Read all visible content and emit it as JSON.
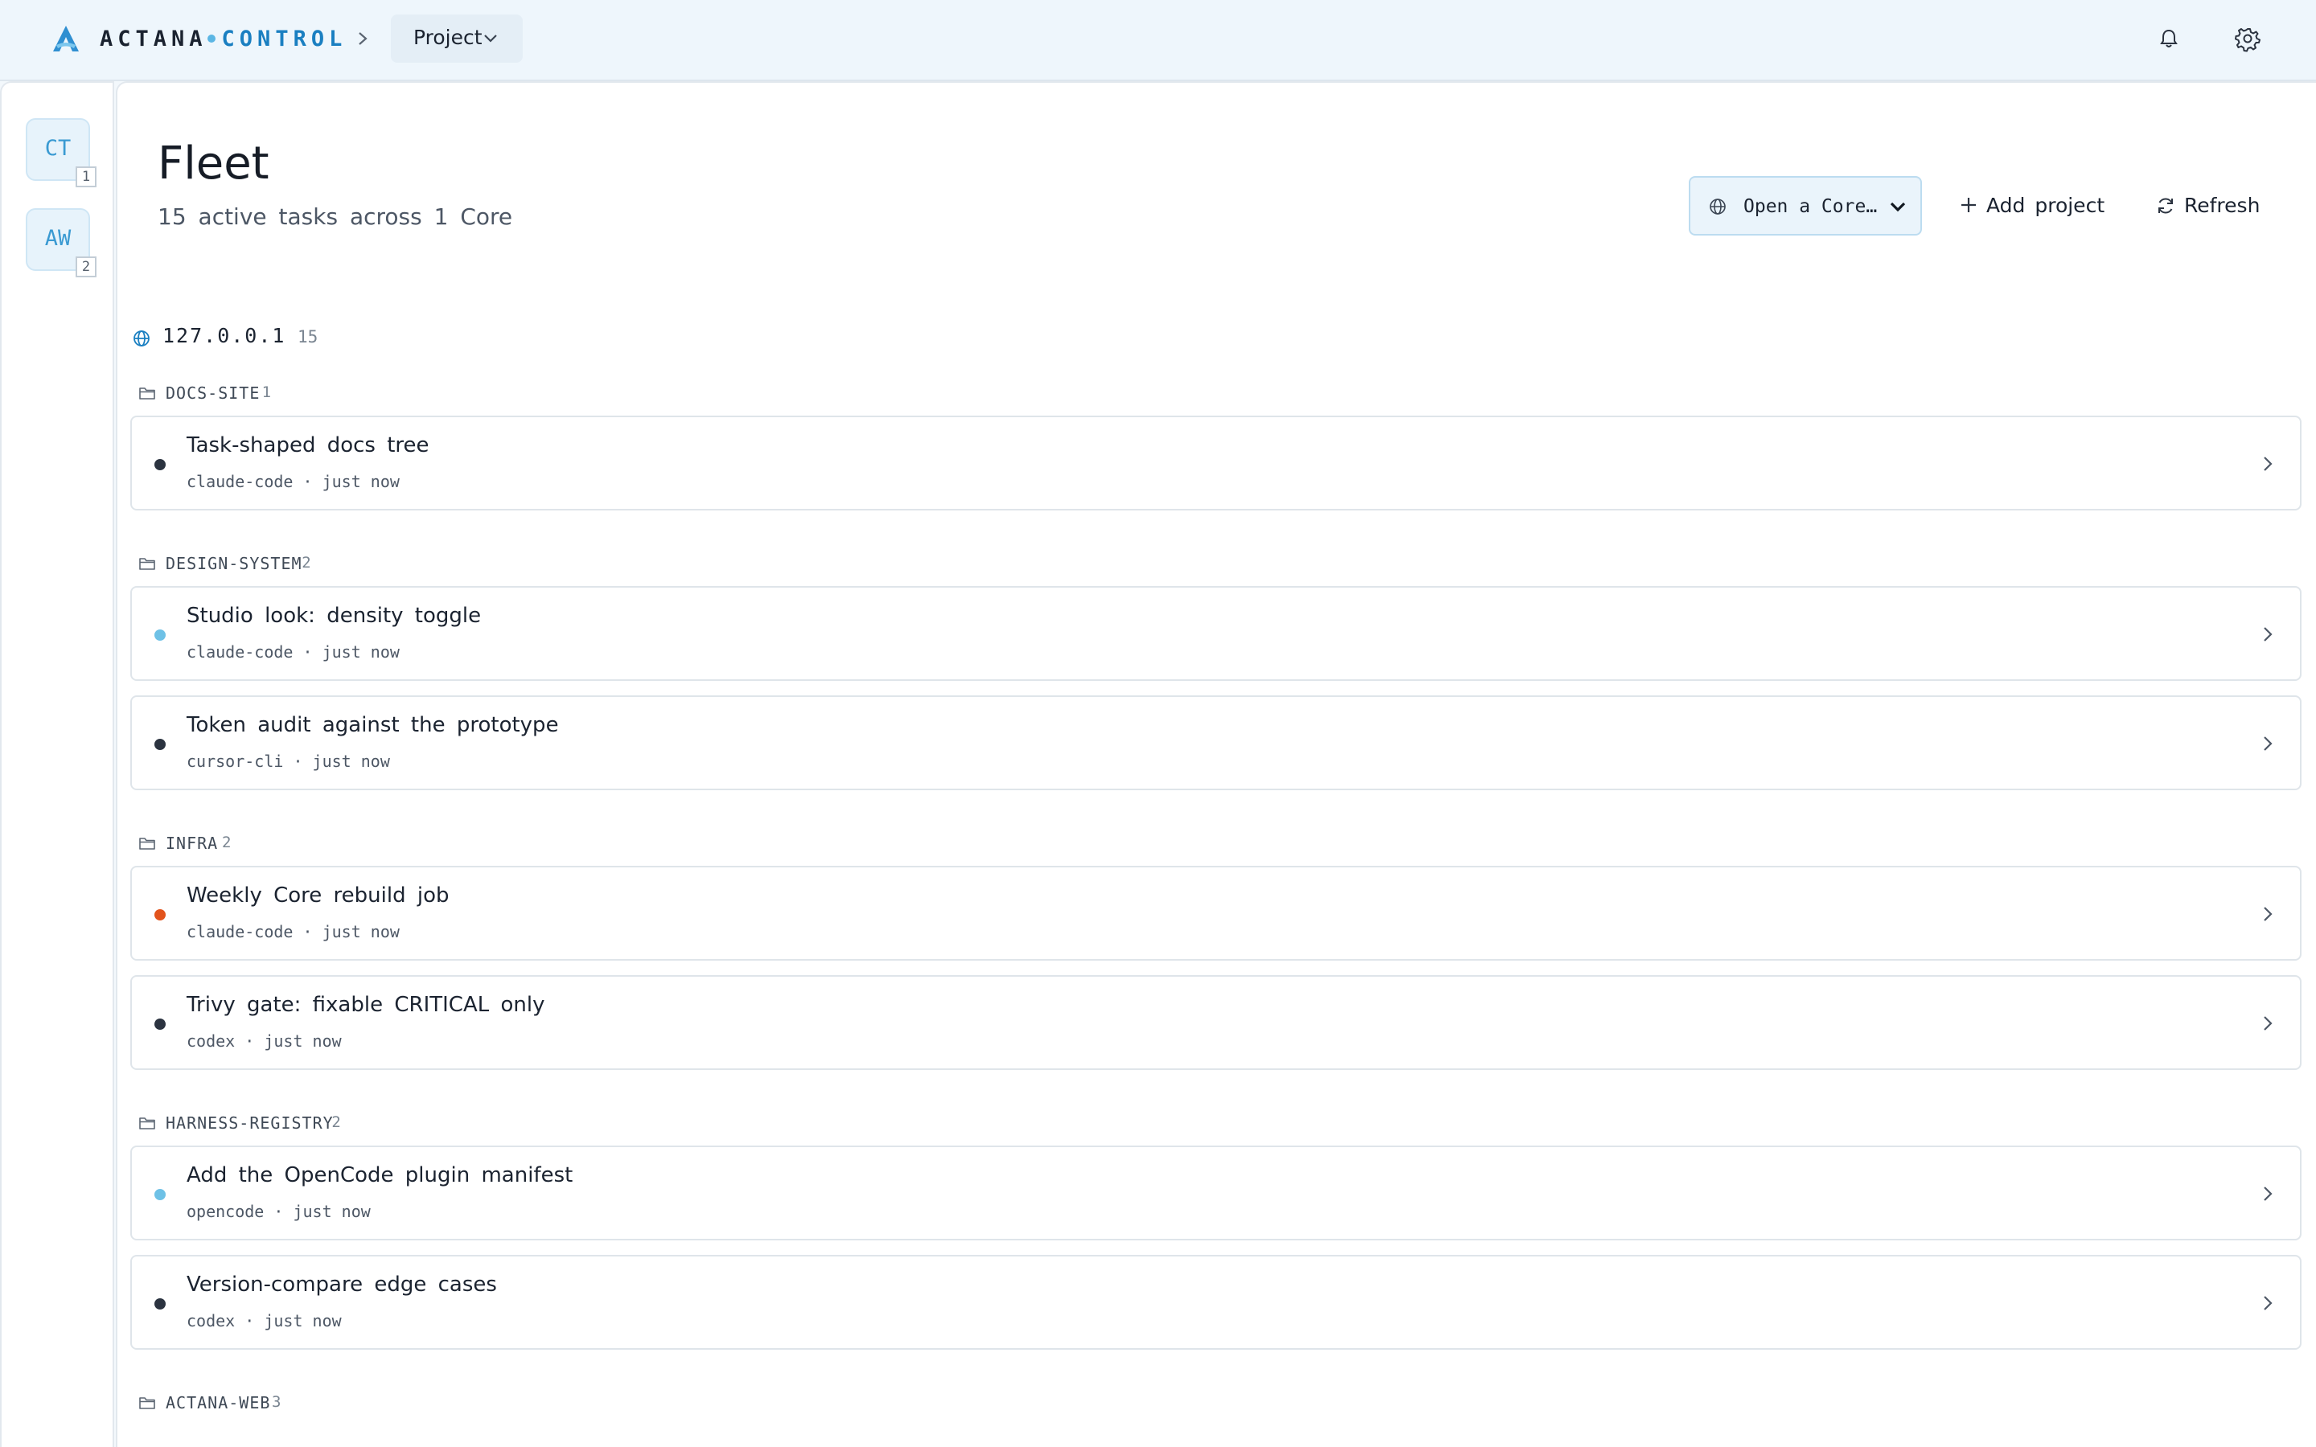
{
  "header": {
    "brand_left": "ACTANA",
    "brand_right": "CONTROL",
    "project_label": "Project",
    "icons": [
      "actana-logo-icon",
      "chevron-right-icon",
      "chevron-down-icon",
      "bell-icon",
      "gear-icon"
    ]
  },
  "rail": {
    "workspaces": [
      {
        "initials": "CT",
        "count": "1"
      },
      {
        "initials": "AW",
        "count": "2"
      }
    ]
  },
  "page": {
    "title": "Fleet",
    "subtitle": "15 active tasks across 1 Core",
    "open_core_label": "Open a Core…",
    "add_project_label": "Add project",
    "refresh_label": "Refresh"
  },
  "host": {
    "name": "127.0.0.1",
    "count": "15"
  },
  "colors": {
    "accent": "#1a7fc1",
    "status_idle": "#2b3340",
    "status_active": "#6ec1e6",
    "status_alert": "#e2531c"
  },
  "groups": [
    {
      "name": "DOCS-SITE",
      "count": "1",
      "tasks": [
        {
          "title": "Task-shaped docs tree",
          "agent": "claude-code",
          "time": "just now",
          "status": "idle"
        }
      ]
    },
    {
      "name": "DESIGN-SYSTEM",
      "count": "2",
      "tasks": [
        {
          "title": "Studio look: density toggle",
          "agent": "claude-code",
          "time": "just now",
          "status": "active"
        },
        {
          "title": "Token audit against the prototype",
          "agent": "cursor-cli",
          "time": "just now",
          "status": "idle"
        }
      ]
    },
    {
      "name": "INFRA",
      "count": "2",
      "tasks": [
        {
          "title": "Weekly Core rebuild job",
          "agent": "claude-code",
          "time": "just now",
          "status": "alert"
        },
        {
          "title": "Trivy gate: fixable CRITICAL only",
          "agent": "codex",
          "time": "just now",
          "status": "idle"
        }
      ]
    },
    {
      "name": "HARNESS-REGISTRY",
      "count": "2",
      "tasks": [
        {
          "title": "Add the OpenCode plugin manifest",
          "agent": "opencode",
          "time": "just now",
          "status": "active"
        },
        {
          "title": "Version-compare edge cases",
          "agent": "codex",
          "time": "just now",
          "status": "idle"
        }
      ]
    },
    {
      "name": "ACTANA-WEB",
      "count": "3",
      "tasks": []
    }
  ]
}
